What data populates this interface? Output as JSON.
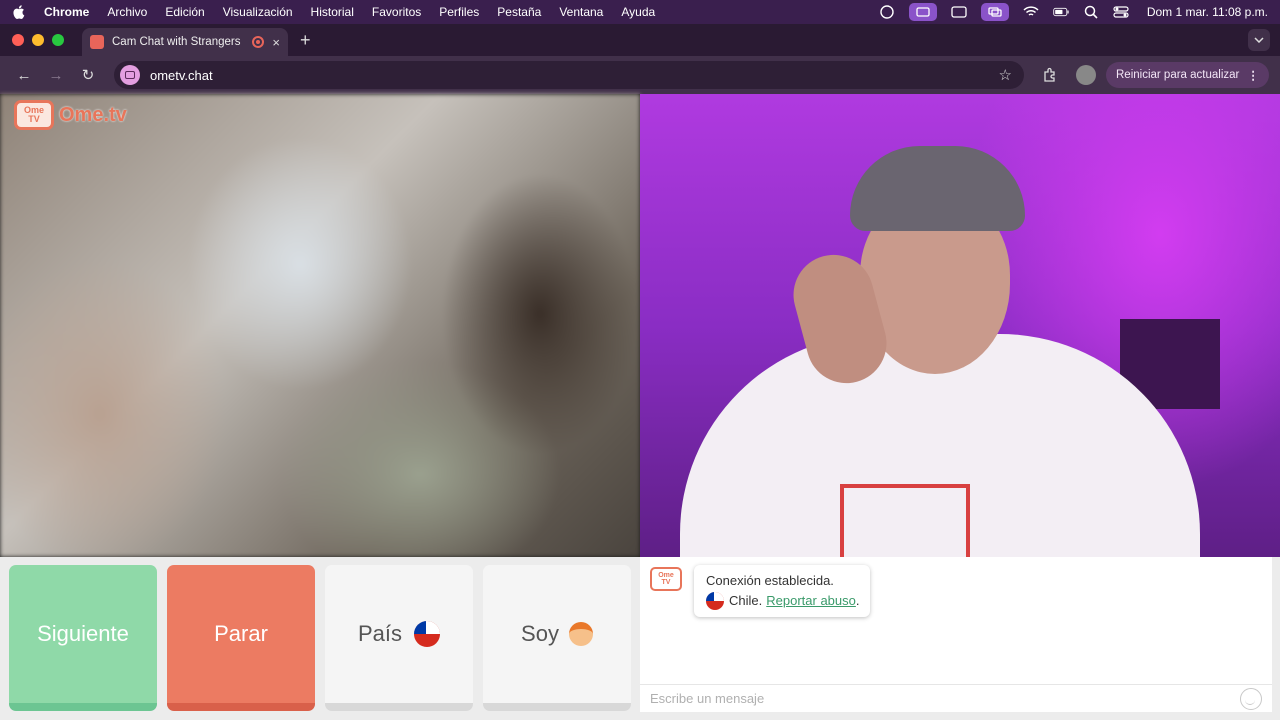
{
  "menubar": {
    "app": "Chrome",
    "items": [
      "Archivo",
      "Edición",
      "Visualización",
      "Historial",
      "Favoritos",
      "Perfiles",
      "Pestaña",
      "Ventana",
      "Ayuda"
    ],
    "clock": "Dom 1 mar.  11:08 p.m."
  },
  "tab": {
    "title": "Cam Chat with Strangers",
    "close": "×",
    "new_tab": "+"
  },
  "toolbar": {
    "back": "←",
    "forward": "→",
    "reload": "↻",
    "url": "ometv.chat",
    "star": "☆",
    "update_label": "Reiniciar para actualizar",
    "kebab": "⋮"
  },
  "logo": {
    "tv_top": "Ome",
    "tv_bottom": "TV",
    "word": "Ome.tv"
  },
  "controls": {
    "next": "Siguiente",
    "stop": "Parar",
    "country": "País",
    "gender": "Soy"
  },
  "chat": {
    "connected": "Conexión establecida.",
    "country": "Chile.",
    "report": "Reportar abuso",
    "report_suffix": ".",
    "placeholder": "Escribe un mensaje"
  }
}
